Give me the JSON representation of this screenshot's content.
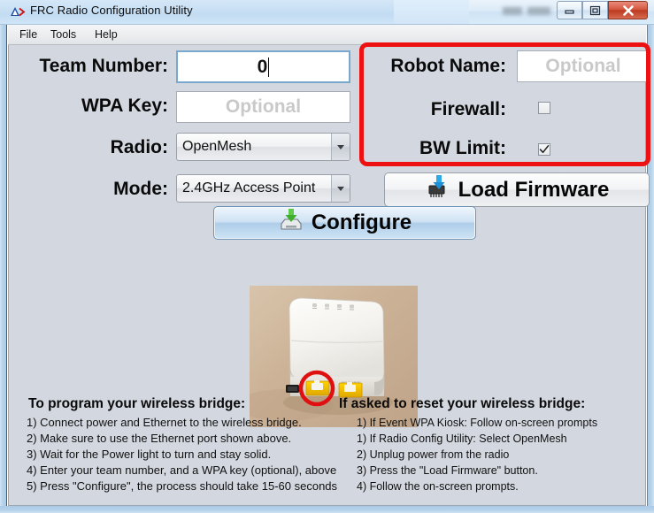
{
  "window": {
    "title": "FRC Radio Configuration Utility",
    "app_icon": "frc-logo-icon",
    "minimize_label": "Minimize",
    "maximize_label": "Maximize",
    "close_label": "Close"
  },
  "menubar": {
    "items": [
      {
        "label": "File"
      },
      {
        "label": "Tools"
      },
      {
        "label": "Help"
      }
    ]
  },
  "form": {
    "team_number": {
      "label": "Team Number:",
      "value": "0"
    },
    "wpa_key": {
      "label": "WPA Key:",
      "value": "",
      "placeholder": "Optional"
    },
    "radio": {
      "label": "Radio:",
      "value": "OpenMesh"
    },
    "mode": {
      "label": "Mode:",
      "value": "2.4GHz Access Point"
    }
  },
  "highlight_panel": {
    "border_color": "#ee1111",
    "robot_name": {
      "label": "Robot Name:",
      "value": "",
      "placeholder": "Optional"
    },
    "firewall": {
      "label": "Firewall:",
      "checked": false
    },
    "bw_limit": {
      "label": "BW Limit:",
      "checked": true
    }
  },
  "buttons": {
    "load_firmware": {
      "label": "Load Firmware",
      "icon": "chip-download-icon"
    },
    "configure": {
      "label": "Configure",
      "icon": "drive-download-icon",
      "focused": true
    }
  },
  "photo": {
    "alt": "OpenMesh wireless bridge with ethernet port circled in red",
    "annotation_color": "#e01010"
  },
  "instructions": {
    "left": {
      "heading": "To program your wireless bridge:",
      "lines": [
        "1) Connect power and Ethernet to the wireless bridge.",
        "2) Make sure to use the Ethernet port shown above.",
        "3) Wait for the Power light to turn and stay solid.",
        "4) Enter your team number, and a WPA key (optional), above",
        "5) Press \"Configure\", the process should take 15-60 seconds"
      ]
    },
    "right": {
      "heading": "If asked to reset your wireless bridge:",
      "lines": [
        "1) If Event WPA Kiosk: Follow on-screen prompts",
        "1) If Radio Config Utility: Select OpenMesh",
        "2) Unplug power from the radio",
        "3) Press the \"Load Firmware\" button.",
        "4) Follow the on-screen prompts."
      ]
    }
  }
}
